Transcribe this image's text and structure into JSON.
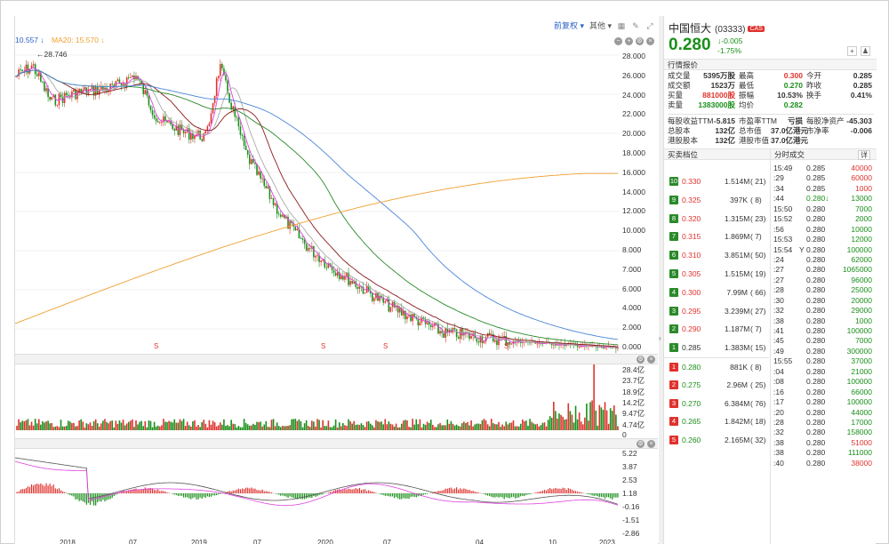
{
  "toolbar": {
    "adjust_label": "前复权 ▾",
    "other_label": "其他 ▾"
  },
  "ma_legend": [
    {
      "text": "10.557 ↓",
      "color": "#2c63c6"
    },
    {
      "text": "MA20: 15.570 ↓",
      "color": "#f0a030"
    }
  ],
  "high_marker": "28.746",
  "price_axis": [
    "28.000",
    "26.000",
    "24.000",
    "22.000",
    "20.000",
    "18.000",
    "16.000",
    "14.000",
    "12.000",
    "10.000",
    "8.000",
    "7.000",
    "6.000",
    "4.000",
    "2.000",
    "0.000"
  ],
  "volume_axis": [
    "28.4亿",
    "23.7亿",
    "18.9亿",
    "14.2亿",
    "9.47亿",
    "4.74亿",
    "0"
  ],
  "macd_axis": [
    "5.22",
    "3.87",
    "2.53",
    "1.18",
    "-0.16",
    "-1.51",
    "-2.86"
  ],
  "x_labels": [
    "2018",
    "07",
    "2019",
    "07",
    "2020",
    "07",
    "04",
    "10",
    "2023"
  ],
  "split_markers": [
    "S",
    "S",
    "S",
    "S"
  ],
  "stock": {
    "name": "中国恒大",
    "code": "(03333)",
    "tag": "CAS",
    "price": "0.280",
    "change": "↓-0.005",
    "change_pct": "-1.75%",
    "quote_title": "行情报价",
    "quote_rows": [
      [
        "成交量",
        "5395万股",
        "最高",
        "0.300",
        "今开",
        "0.285"
      ],
      [
        "成交额",
        "1523万",
        "最低",
        "0.270",
        "昨收",
        "0.285"
      ],
      [
        "买量",
        "881000股",
        "振幅",
        "10.53%",
        "换手",
        "0.41%"
      ],
      [
        "卖量",
        "1383000股",
        "均价",
        "0.282",
        "",
        ""
      ]
    ],
    "fin_rows": [
      [
        "每股收益TTM",
        "-5.815",
        "市盈率TTM",
        "亏损",
        "每股净资产",
        "-45.303"
      ],
      [
        "总股本",
        "132亿",
        "总市值",
        "37.0亿港元",
        "市净率",
        "-0.006"
      ],
      [
        "港股股本",
        "132亿",
        "港股市值",
        "37.0亿港元",
        "",
        ""
      ]
    ],
    "book_title": "买卖档位",
    "ticks_title": "分时成交",
    "detail_label": "详",
    "asks": [
      {
        "lvl": "10",
        "price": "0.330",
        "vol": "1.514M",
        "cnt": "( 21)"
      },
      {
        "lvl": "9",
        "price": "0.325",
        "vol": "397K",
        "cnt": "( 8)"
      },
      {
        "lvl": "8",
        "price": "0.320",
        "vol": "1.315M",
        "cnt": "( 23)"
      },
      {
        "lvl": "7",
        "price": "0.315",
        "vol": "1.869M",
        "cnt": "( 7)"
      },
      {
        "lvl": "6",
        "price": "0.310",
        "vol": "3.851M",
        "cnt": "( 50)"
      },
      {
        "lvl": "5",
        "price": "0.305",
        "vol": "1.515M",
        "cnt": "( 19)"
      },
      {
        "lvl": "4",
        "price": "0.300",
        "vol": "7.99M",
        "cnt": "( 66)"
      },
      {
        "lvl": "3",
        "price": "0.295",
        "vol": "3.239M",
        "cnt": "( 27)"
      },
      {
        "lvl": "2",
        "price": "0.290",
        "vol": "1.187M",
        "cnt": "( 7)"
      },
      {
        "lvl": "1",
        "price": "0.285",
        "vol": "1.383M",
        "cnt": "( 15)"
      }
    ],
    "bids": [
      {
        "lvl": "1",
        "price": "0.280",
        "vol": "881K",
        "cnt": "( 8)"
      },
      {
        "lvl": "2",
        "price": "0.275",
        "vol": "2.96M",
        "cnt": "( 25)"
      },
      {
        "lvl": "3",
        "price": "0.270",
        "vol": "6.384M",
        "cnt": "( 76)"
      },
      {
        "lvl": "4",
        "price": "0.265",
        "vol": "1.842M",
        "cnt": "( 18)"
      },
      {
        "lvl": "5",
        "price": "0.260",
        "vol": "2.165M",
        "cnt": "( 32)"
      }
    ],
    "ticks": [
      {
        "t": "15:49",
        "f": "",
        "p": "0.285",
        "v": "40000",
        "c": "red"
      },
      {
        "t": ":29",
        "f": "",
        "p": "0.285",
        "v": "60000",
        "c": "red"
      },
      {
        "t": ":34",
        "f": "",
        "p": "0.285",
        "v": "1000",
        "c": "red"
      },
      {
        "t": ":44",
        "f": "",
        "p": "0.280↓",
        "v": "13000",
        "c": "grn"
      },
      {
        "t": "15:50",
        "f": "",
        "p": "0.280",
        "v": "7000",
        "c": "grn"
      },
      {
        "t": "15:52",
        "f": "",
        "p": "0.280",
        "v": "2000",
        "c": "grn"
      },
      {
        "t": ":56",
        "f": "",
        "p": "0.280",
        "v": "10000",
        "c": "grn"
      },
      {
        "t": "15:53",
        "f": "",
        "p": "0.280",
        "v": "12000",
        "c": "grn"
      },
      {
        "t": "15:54",
        "f": "Y",
        "p": "0.280",
        "v": "100000",
        "c": "grn"
      },
      {
        "t": ":24",
        "f": "",
        "p": "0.280",
        "v": "62000",
        "c": "grn"
      },
      {
        "t": ":27",
        "f": "",
        "p": "0.280",
        "v": "1065000",
        "c": "grn"
      },
      {
        "t": ":27",
        "f": "",
        "p": "0.280",
        "v": "96000",
        "c": "grn"
      },
      {
        "t": ":28",
        "f": "",
        "p": "0.280",
        "v": "25000",
        "c": "grn"
      },
      {
        "t": ":30",
        "f": "",
        "p": "0.280",
        "v": "20000",
        "c": "grn"
      },
      {
        "t": ":32",
        "f": "",
        "p": "0.280",
        "v": "29000",
        "c": "grn"
      },
      {
        "t": ":38",
        "f": "",
        "p": "0.280",
        "v": "1000",
        "c": "grn"
      },
      {
        "t": ":41",
        "f": "",
        "p": "0.280",
        "v": "100000",
        "c": "grn"
      },
      {
        "t": ":45",
        "f": "",
        "p": "0.280",
        "v": "7000",
        "c": "grn"
      },
      {
        "t": ":49",
        "f": "",
        "p": "0.280",
        "v": "300000",
        "c": "grn"
      },
      {
        "t": "15:55",
        "f": "",
        "p": "0.280",
        "v": "37000",
        "c": "grn"
      },
      {
        "t": ":04",
        "f": "",
        "p": "0.280",
        "v": "21000",
        "c": "grn"
      },
      {
        "t": ":08",
        "f": "",
        "p": "0.280",
        "v": "100000",
        "c": "grn"
      },
      {
        "t": ":16",
        "f": "",
        "p": "0.280",
        "v": "66000",
        "c": "grn"
      },
      {
        "t": ":17",
        "f": "",
        "p": "0.280",
        "v": "100000",
        "c": "grn"
      },
      {
        "t": ":20",
        "f": "",
        "p": "0.280",
        "v": "44000",
        "c": "grn"
      },
      {
        "t": ":28",
        "f": "",
        "p": "0.280",
        "v": "17000",
        "c": "grn"
      },
      {
        "t": ":32",
        "f": "",
        "p": "0.280",
        "v": "158000",
        "c": "grn"
      },
      {
        "t": ":38",
        "f": "",
        "p": "0.280",
        "v": "51000",
        "c": "red"
      },
      {
        "t": ":38",
        "f": "",
        "p": "0.280",
        "v": "111000",
        "c": "grn"
      },
      {
        "t": ":40",
        "f": "",
        "p": "0.280",
        "v": "38000",
        "c": "red"
      }
    ]
  },
  "colors": {
    "up": "#e0322d",
    "down": "#1a8f1a",
    "ma5": "#e040e0",
    "ma10": "#aaaaaa",
    "ma20": "#8b1a1a",
    "ma60": "#2a8a2a",
    "ma120": "#4a86d8",
    "ma250": "#f0a030"
  }
}
